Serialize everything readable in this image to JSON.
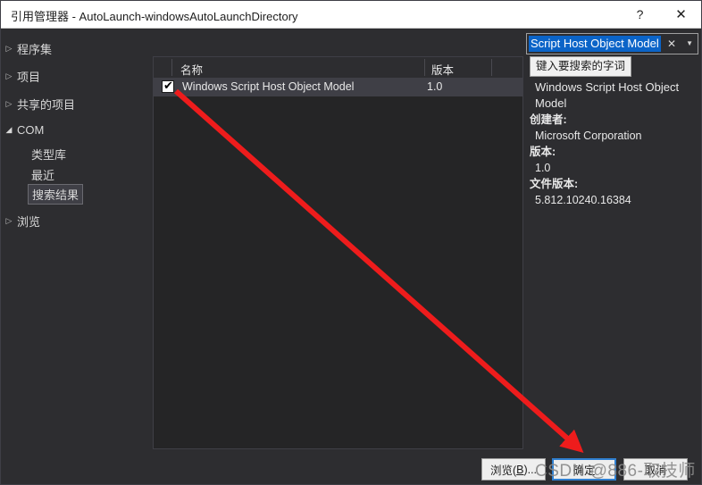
{
  "window": {
    "title": "引用管理器 - AutoLaunch-windowsAutoLaunchDirectory",
    "help_label": "?",
    "close_label": "✕"
  },
  "sidebar": {
    "items": [
      {
        "label": "程序集",
        "arrow": "▷",
        "expanded": false
      },
      {
        "label": "项目",
        "arrow": "▷",
        "expanded": false
      },
      {
        "label": "共享的项目",
        "arrow": "▷",
        "expanded": false
      },
      {
        "label": "COM",
        "arrow": "◢",
        "expanded": true
      },
      {
        "label": "浏览",
        "arrow": "▷",
        "expanded": false
      }
    ],
    "com_children": [
      {
        "label": "类型库",
        "selected": false
      },
      {
        "label": "最近",
        "selected": false
      },
      {
        "label": "搜索结果",
        "selected": true
      }
    ]
  },
  "list": {
    "columns": [
      "名称",
      "版本"
    ],
    "rows": [
      {
        "checked": true,
        "check_glyph": "✔",
        "name": "Windows Script Host Object Model",
        "version": "1.0"
      }
    ]
  },
  "search": {
    "value": "Script Host Object Model",
    "placeholder": "键入要搜索的字词",
    "clear_label": "✕",
    "dropdown_label": "▼",
    "tooltip": "键入要搜索的字词"
  },
  "details": {
    "title": "Windows Script Host Object Model",
    "fields": [
      {
        "label": "创建者:",
        "value": "Microsoft Corporation"
      },
      {
        "label": "版本:",
        "value": "1.0"
      },
      {
        "label": "文件版本:",
        "value": "5.812.10240.16384"
      }
    ]
  },
  "footer": {
    "browse_prefix": "浏览(",
    "browse_accel": "B",
    "browse_suffix": ")...",
    "ok_label": "确定",
    "cancel_label": "取消"
  },
  "annotation": {
    "watermark": "CSDN @886-取技师",
    "arrow_color": "#ee1c1c"
  },
  "colors": {
    "accent": "#0b64c8",
    "window_bg": "#2d2d30",
    "panel_bg": "#252526",
    "selection": "#3f3f46"
  }
}
